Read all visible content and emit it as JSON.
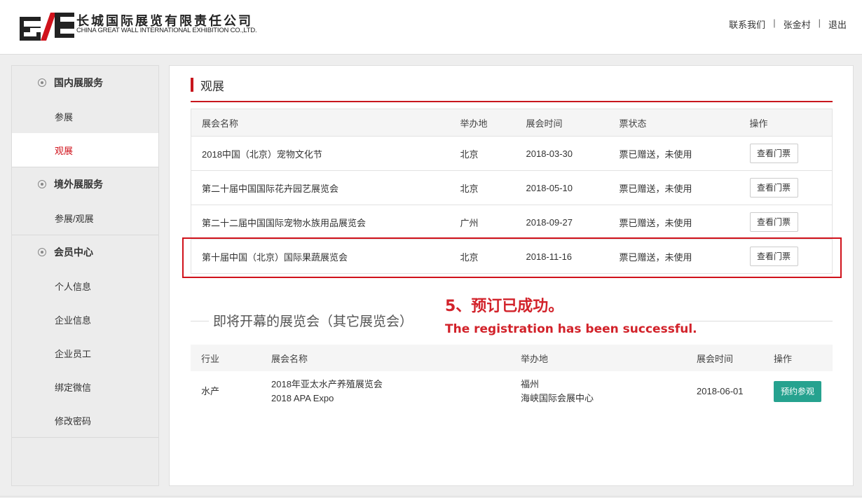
{
  "header": {
    "company_cn": "长城国际展览有限责任公司",
    "company_en": "CHINA GREAT WALL INTERNATIONAL EXHIBITION CO.,LTD.",
    "nav": {
      "contact": "联系我们",
      "sep": "|",
      "user": "张金村",
      "logout": "退出"
    }
  },
  "sidebar": {
    "groups": [
      {
        "title": "国内展服务",
        "items": [
          "参展",
          "观展"
        ]
      },
      {
        "title": "境外展服务",
        "items": [
          "参展/观展"
        ]
      },
      {
        "title": "会员中心",
        "items": [
          "个人信息",
          "企业信息",
          "企业员工",
          "绑定微信",
          "修改密码"
        ]
      }
    ],
    "active_item": "观展"
  },
  "main": {
    "section_title": "观展",
    "visit_table": {
      "headers": [
        "展会名称",
        "举办地",
        "展会时间",
        "票状态",
        "操作"
      ],
      "rows": [
        {
          "name": "2018中国（北京）宠物文化节",
          "city": "北京",
          "date": "2018-03-30",
          "status": "票已赠送，未使用",
          "action": "查看门票"
        },
        {
          "name": "第二十届中国国际花卉园艺展览会",
          "city": "北京",
          "date": "2018-05-10",
          "status": "票已赠送，未使用",
          "action": "查看门票"
        },
        {
          "name": "第二十二届中国国际宠物水族用品展览会",
          "city": "广州",
          "date": "2018-09-27",
          "status": "票已赠送，未使用",
          "action": "查看门票"
        },
        {
          "name": "第十届中国（北京）国际果蔬展览会",
          "city": "北京",
          "date": "2018-11-16",
          "status": "票已赠送，未使用",
          "action": "查看门票"
        }
      ]
    },
    "annotation": {
      "cn": "5、预订已成功。",
      "en": "The registration has been successful."
    },
    "upcoming_title": "即将开幕的展览会（其它展览会）",
    "upcoming_table": {
      "headers": [
        "行业",
        "展会名称",
        "举办地",
        "展会时间",
        "操作"
      ],
      "rows": [
        {
          "industry": "水产",
          "name_cn": "2018年亚太水产养殖展览会",
          "name_en": "2018 APA Expo",
          "city": "福州",
          "venue": "海峡国际会展中心",
          "date": "2018-06-01",
          "action": "预约参观"
        }
      ]
    }
  },
  "colors": {
    "accent_red": "#c8161d",
    "book_green": "#26a28f"
  }
}
